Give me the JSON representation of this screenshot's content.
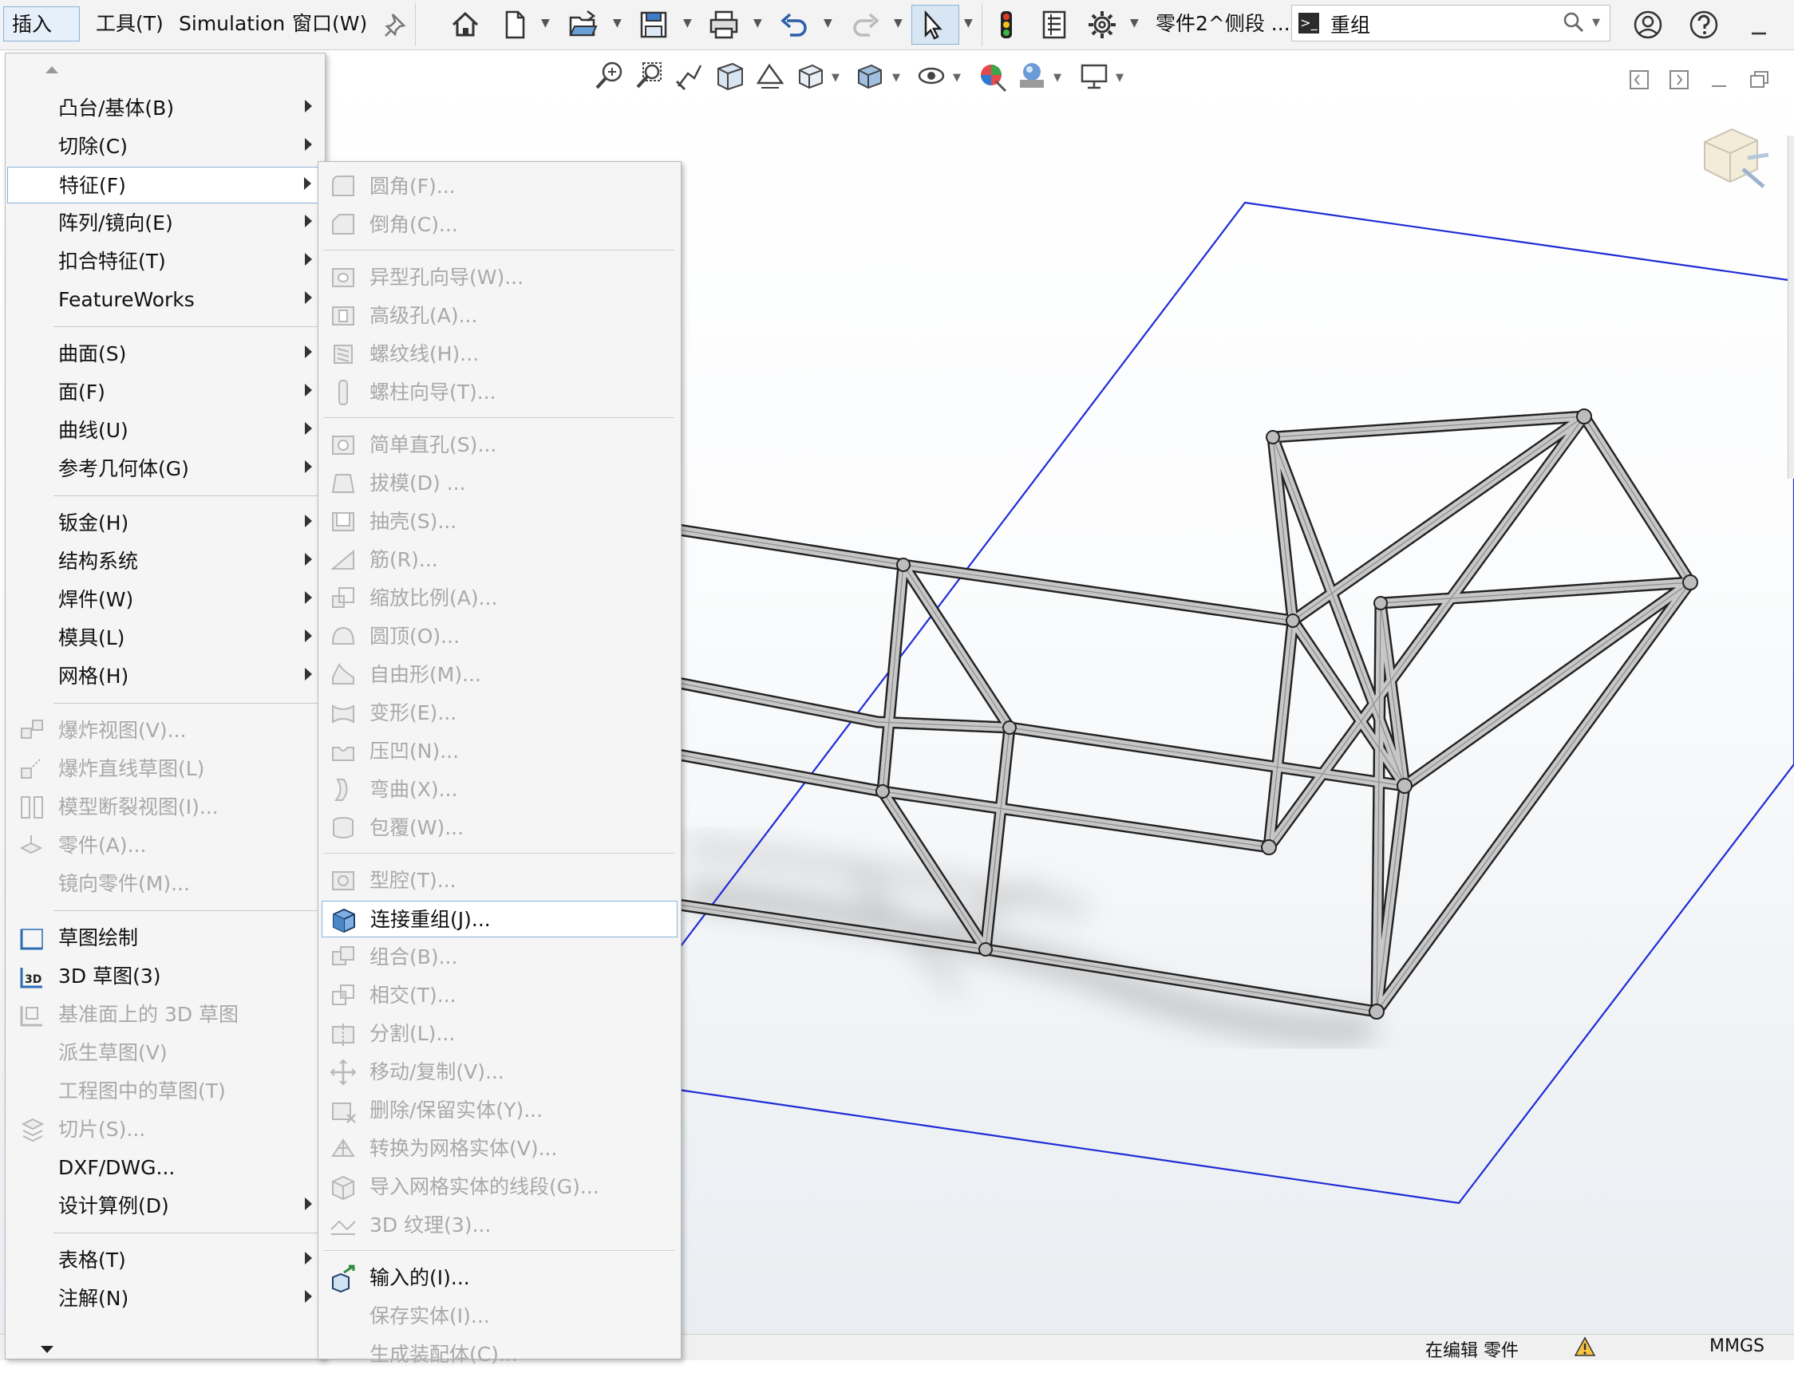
{
  "menubar": {
    "items": [
      {
        "label": "插入(I)"
      },
      {
        "label": "工具(T)"
      },
      {
        "label": "Simulation"
      },
      {
        "label": "窗口(W)"
      }
    ],
    "doc_title": "零件2^侧段 ...",
    "search_value": "重组"
  },
  "insert_menu": {
    "items": [
      {
        "label": "凸台/基体(B)",
        "submenu": true,
        "enabled": true
      },
      {
        "label": "切除(C)",
        "submenu": true,
        "enabled": true
      },
      {
        "label": "特征(F)",
        "submenu": true,
        "enabled": true,
        "active": true
      },
      {
        "label": "阵列/镜向(E)",
        "submenu": true,
        "enabled": true
      },
      {
        "label": "扣合特征(T)",
        "submenu": true,
        "enabled": true
      },
      {
        "label": "FeatureWorks",
        "submenu": true,
        "enabled": true
      },
      {
        "label": "曲面(S)",
        "submenu": true,
        "enabled": true
      },
      {
        "label": "面(F)",
        "submenu": true,
        "enabled": true
      },
      {
        "label": "曲线(U)",
        "submenu": true,
        "enabled": true
      },
      {
        "label": "参考几何体(G)",
        "submenu": true,
        "enabled": true
      },
      {
        "label": "钣金(H)",
        "submenu": true,
        "enabled": true
      },
      {
        "label": "结构系统",
        "submenu": true,
        "enabled": true
      },
      {
        "label": "焊件(W)",
        "submenu": true,
        "enabled": true
      },
      {
        "label": "模具(L)",
        "submenu": true,
        "enabled": true
      },
      {
        "label": "网格(H)",
        "submenu": true,
        "enabled": true
      },
      {
        "label": "爆炸视图(V)...",
        "icon": "explode-view-icon",
        "enabled": false
      },
      {
        "label": "爆炸直线草图(L)",
        "icon": "explode-line-icon",
        "enabled": false
      },
      {
        "label": "模型断裂视图(I)...",
        "icon": "break-view-icon",
        "enabled": false
      },
      {
        "label": "零件(A)...",
        "icon": "part-icon",
        "enabled": false
      },
      {
        "label": "镜向零件(M)...",
        "enabled": false
      },
      {
        "label": "草图绘制",
        "icon": "sketch-icon",
        "enabled": true
      },
      {
        "label": "3D 草图(3)",
        "icon": "3d-sketch-icon",
        "enabled": true
      },
      {
        "label": "基准面上的 3D 草图",
        "icon": "3d-sketch-plane-icon",
        "enabled": false
      },
      {
        "label": "派生草图(V)",
        "enabled": false
      },
      {
        "label": "工程图中的草图(T)",
        "enabled": false
      },
      {
        "label": "切片(S)...",
        "icon": "slice-icon",
        "enabled": false
      },
      {
        "label": "DXF/DWG...",
        "enabled": true
      },
      {
        "label": "设计算例(D)",
        "submenu": true,
        "enabled": true
      },
      {
        "label": "表格(T)",
        "submenu": true,
        "enabled": true
      },
      {
        "label": "注解(N)",
        "submenu": true,
        "enabled": true
      }
    ]
  },
  "feature_submenu": {
    "items": [
      {
        "label": "圆角(F)...",
        "icon": "fillet-icon",
        "enabled": false
      },
      {
        "label": "倒角(C)...",
        "icon": "chamfer-icon",
        "enabled": false
      },
      {
        "label": "异型孔向导(W)...",
        "icon": "hole-wizard-icon",
        "enabled": false
      },
      {
        "label": "高级孔(A)...",
        "icon": "advanced-hole-icon",
        "enabled": false
      },
      {
        "label": "螺纹线(H)...",
        "icon": "thread-icon",
        "enabled": false
      },
      {
        "label": "螺柱向导(T)...",
        "icon": "stud-wizard-icon",
        "enabled": false
      },
      {
        "label": "简单直孔(S)...",
        "icon": "simple-hole-icon",
        "enabled": false
      },
      {
        "label": "拔模(D) ...",
        "icon": "draft-icon",
        "enabled": false
      },
      {
        "label": "抽壳(S)...",
        "icon": "shell-icon",
        "enabled": false
      },
      {
        "label": "筋(R)...",
        "icon": "rib-icon",
        "enabled": false
      },
      {
        "label": "缩放比例(A)...",
        "icon": "scale-icon",
        "enabled": false
      },
      {
        "label": "圆顶(O)...",
        "icon": "dome-icon",
        "enabled": false
      },
      {
        "label": "自由形(M)...",
        "icon": "freeform-icon",
        "enabled": false
      },
      {
        "label": "变形(E)...",
        "icon": "deform-icon",
        "enabled": false
      },
      {
        "label": "压凹(N)...",
        "icon": "indent-icon",
        "enabled": false
      },
      {
        "label": "弯曲(X)...",
        "icon": "flex-icon",
        "enabled": false
      },
      {
        "label": "包覆(W)...",
        "icon": "wrap-icon",
        "enabled": false
      },
      {
        "label": "型腔(T)...",
        "icon": "cavity-icon",
        "enabled": false
      },
      {
        "label": "连接重组(J)...",
        "icon": "join-icon",
        "enabled": true,
        "active": true
      },
      {
        "label": "组合(B)...",
        "icon": "combine-icon",
        "enabled": false
      },
      {
        "label": "相交(T)...",
        "icon": "intersect-icon",
        "enabled": false
      },
      {
        "label": "分割(L)...",
        "icon": "split-icon",
        "enabled": false
      },
      {
        "label": "移动/复制(V)...",
        "icon": "move-copy-icon",
        "enabled": false
      },
      {
        "label": "删除/保留实体(Y)...",
        "icon": "delete-body-icon",
        "enabled": false
      },
      {
        "label": "转换为网格实体(V)...",
        "icon": "mesh-convert-icon",
        "enabled": false
      },
      {
        "label": "导入网格实体的线段(G)...",
        "icon": "mesh-segment-icon",
        "enabled": false
      },
      {
        "label": "3D 纹理(3)...",
        "icon": "texture-icon",
        "enabled": false
      },
      {
        "label": "输入的(I)...",
        "icon": "import-icon",
        "enabled": true
      },
      {
        "label": "保存实体(I)...",
        "enabled": false
      },
      {
        "label": "生成装配体(C)...",
        "enabled": false
      }
    ]
  },
  "statusbar": {
    "mode": "在编辑 零件",
    "units": "MMGS"
  },
  "colors": {
    "sketch_plane": "#1f2bd6",
    "menu_highlight_border": "#8ab2d9",
    "disabled_text": "#a9a9a9"
  }
}
